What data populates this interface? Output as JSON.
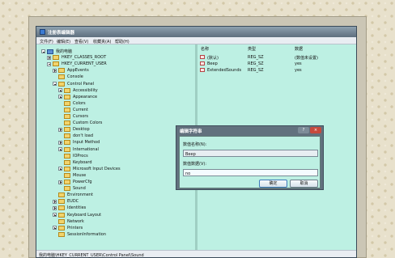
{
  "window": {
    "title": "注册表编辑器",
    "menu": [
      "文件(F)",
      "编辑(E)",
      "查看(V)",
      "收藏夹(A)",
      "帮助(H)"
    ]
  },
  "tree": [
    {
      "label": "我的电脑",
      "icon": "computer",
      "expander": "minus",
      "level": 0
    },
    {
      "label": "HKEY_CLASSES_ROOT",
      "icon": "folder",
      "expander": "plus",
      "level": 1
    },
    {
      "label": "HKEY_CURRENT_USER",
      "icon": "folder",
      "expander": "minus",
      "level": 1
    },
    {
      "label": "AppEvents",
      "icon": "folder",
      "expander": "plus",
      "level": 2
    },
    {
      "label": "Console",
      "icon": "folder",
      "expander": "none",
      "level": 2
    },
    {
      "label": "Control Panel",
      "icon": "folder",
      "expander": "minus",
      "level": 2
    },
    {
      "label": "Accessibility",
      "icon": "folder",
      "expander": "plus",
      "level": 3
    },
    {
      "label": "Appearance",
      "icon": "folder",
      "expander": "plus",
      "level": 3
    },
    {
      "label": "Colors",
      "icon": "folder",
      "expander": "none",
      "level": 3
    },
    {
      "label": "Current",
      "icon": "folder",
      "expander": "none",
      "level": 3
    },
    {
      "label": "Cursors",
      "icon": "folder",
      "expander": "none",
      "level": 3
    },
    {
      "label": "Custom Colors",
      "icon": "folder",
      "expander": "none",
      "level": 3
    },
    {
      "label": "Desktop",
      "icon": "folder",
      "expander": "plus",
      "level": 3
    },
    {
      "label": "don't load",
      "icon": "folder",
      "expander": "none",
      "level": 3
    },
    {
      "label": "Input Method",
      "icon": "folder",
      "expander": "plus",
      "level": 3
    },
    {
      "label": "International",
      "icon": "folder",
      "expander": "plus",
      "level": 3
    },
    {
      "label": "IOProcs",
      "icon": "folder",
      "expander": "none",
      "level": 3
    },
    {
      "label": "Keyboard",
      "icon": "folder",
      "expander": "none",
      "level": 3
    },
    {
      "label": "Microsoft Input Devices",
      "icon": "folder",
      "expander": "plus",
      "level": 3
    },
    {
      "label": "Mouse",
      "icon": "folder",
      "expander": "none",
      "level": 3
    },
    {
      "label": "PowerCfg",
      "icon": "folder",
      "expander": "plus",
      "level": 3
    },
    {
      "label": "Sound",
      "icon": "folder",
      "expander": "none",
      "level": 3
    },
    {
      "label": "Environment",
      "icon": "folder",
      "expander": "none",
      "level": 2
    },
    {
      "label": "EUDC",
      "icon": "folder",
      "expander": "plus",
      "level": 2
    },
    {
      "label": "Identities",
      "icon": "folder",
      "expander": "plus",
      "level": 2
    },
    {
      "label": "Keyboard Layout",
      "icon": "folder",
      "expander": "plus",
      "level": 2
    },
    {
      "label": "Network",
      "icon": "folder",
      "expander": "none",
      "level": 2
    },
    {
      "label": "Printers",
      "icon": "folder",
      "expander": "plus",
      "level": 2
    },
    {
      "label": "SessionInformation",
      "icon": "folder",
      "expander": "none",
      "level": 2
    }
  ],
  "list": {
    "columns": [
      "名称",
      "类型",
      "数据"
    ],
    "rows": [
      {
        "name": "(默认)",
        "type": "REG_SZ",
        "data": "(数值未设置)"
      },
      {
        "name": "Beep",
        "type": "REG_SZ",
        "data": "yes"
      },
      {
        "name": "ExtendedSounds",
        "type": "REG_SZ",
        "data": "yes"
      }
    ]
  },
  "status": "我的电脑\\HKEY_CURRENT_USER\\Control Panel\\Sound",
  "dialog": {
    "title": "编辑字符串",
    "help_glyph": "?",
    "close_glyph": "×",
    "name_label": "数值名称(N):",
    "name_value": "Beep",
    "data_label": "数值数据(V):",
    "data_value": "no",
    "ok_label": "确定",
    "cancel_label": "取消"
  },
  "colors": {
    "pane_background": "#bdf0e3",
    "titlebar": "#6e7f8e",
    "page_background": "#e8e1cc"
  }
}
